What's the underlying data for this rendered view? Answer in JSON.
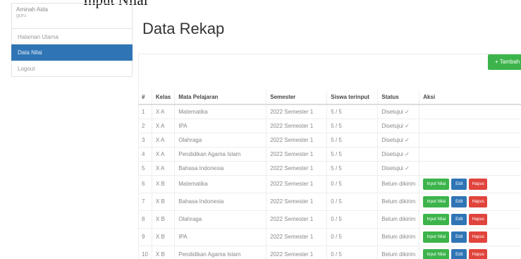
{
  "header": {
    "top_title": "Input Nilai"
  },
  "user": {
    "name": "Aminah Aida",
    "role": "guru"
  },
  "sidebar": {
    "items": [
      {
        "label": "Halaman Utama",
        "active": false
      },
      {
        "label": "Data Nilai",
        "active": true
      },
      {
        "label": "Logout",
        "active": false
      }
    ]
  },
  "page": {
    "title": "Data Rekap",
    "add_button": "+ Tambah"
  },
  "table": {
    "headers": [
      "#",
      "Kelas",
      "Mata Pelajaran",
      "Semester",
      "Siswa terinput",
      "Status",
      "Aksi"
    ],
    "actions": {
      "input": "Input Nilai",
      "edit": "Edit",
      "hapus": "Hapus"
    },
    "rows": [
      {
        "no": "1",
        "kelas": "X A",
        "mapel": "Matematika",
        "semester": "2022 Semester 1",
        "terinput": "5 / 5",
        "status": "Disetujui ✓",
        "approved": true
      },
      {
        "no": "2",
        "kelas": "X A",
        "mapel": "IPA",
        "semester": "2022 Semester 1",
        "terinput": "5 / 5",
        "status": "Disetujui ✓",
        "approved": true
      },
      {
        "no": "3",
        "kelas": "X A",
        "mapel": "Olahraga",
        "semester": "2022 Semester 1",
        "terinput": "5 / 5",
        "status": "Disetujui ✓",
        "approved": true
      },
      {
        "no": "4",
        "kelas": "X A",
        "mapel": "Pendidikan Agama Islam",
        "semester": "2022 Semester 1",
        "terinput": "5 / 5",
        "status": "Disetujui ✓",
        "approved": true
      },
      {
        "no": "5",
        "kelas": "X A",
        "mapel": "Bahasa Indonesia",
        "semester": "2022 Semester 1",
        "terinput": "5 / 5",
        "status": "Disetujui ✓",
        "approved": true
      },
      {
        "no": "6",
        "kelas": "X B",
        "mapel": "Matematika",
        "semester": "2022 Semester 1",
        "terinput": "0 / 5",
        "status": "Belum dikirim",
        "approved": false
      },
      {
        "no": "7",
        "kelas": "X B",
        "mapel": "Bahasa Indonesia",
        "semester": "2022 Semester 1",
        "terinput": "0 / 5",
        "status": "Belum dikirim",
        "approved": false
      },
      {
        "no": "8",
        "kelas": "X B",
        "mapel": "Olahraga",
        "semester": "2022 Semester 1",
        "terinput": "0 / 5",
        "status": "Belum dikirim",
        "approved": false
      },
      {
        "no": "9",
        "kelas": "X B",
        "mapel": "IPA",
        "semester": "2022 Semester 1",
        "terinput": "0 / 5",
        "status": "Belum dikirim",
        "approved": false
      },
      {
        "no": "10",
        "kelas": "X B",
        "mapel": "Pendidikan Agama Islam",
        "semester": "2022 Semester 1",
        "terinput": "0 / 5",
        "status": "Belum dikirim",
        "approved": false
      }
    ]
  },
  "colors": {
    "primary": "#2f75b5",
    "success": "#3cb44b",
    "danger": "#e0443c"
  }
}
